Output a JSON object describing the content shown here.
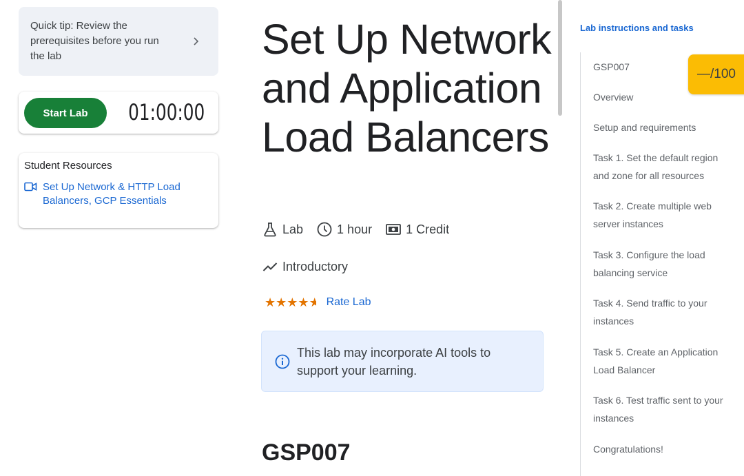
{
  "sidebar": {
    "tip_text": "Quick tip: Review the prerequisites before you run the lab",
    "start_button": "Start Lab",
    "timer": "01:00:00",
    "resources_title": "Student Resources",
    "resource_link": "Set Up Network & HTTP Load Balancers, GCP Essentials"
  },
  "main": {
    "title": "Set Up Network and Application Load Balancers",
    "meta": {
      "type": "Lab",
      "duration": "1 hour",
      "cost": "1 Credit",
      "level": "Introductory"
    },
    "rating_stars": 4.5,
    "rate_link": "Rate Lab",
    "ai_notice": "This lab may incorporate AI tools to support your learning.",
    "section_heading": "GSP007"
  },
  "toc": {
    "header": "Lab instructions and tasks",
    "score": "—/100",
    "items": [
      "GSP007",
      "Overview",
      "Setup and requirements",
      "Task 1. Set the default region and zone for all resources",
      "Task 2. Create multiple web server instances",
      "Task 3. Configure the load balancing service",
      "Task 4. Send traffic to your instances",
      "Task 5. Create an Application Load Balancer",
      "Task 6. Test traffic sent to your instances",
      "Congratulations!"
    ]
  },
  "colors": {
    "accent_green": "#188038",
    "link_blue": "#1967d2",
    "star_orange": "#e37400",
    "score_yellow": "#fbbc04"
  }
}
